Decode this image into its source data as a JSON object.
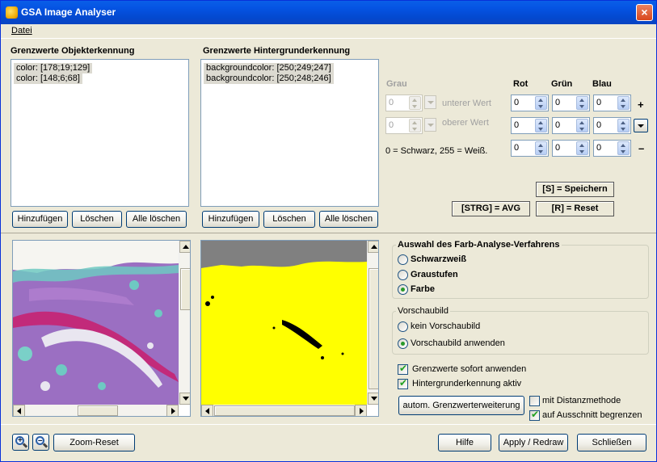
{
  "window": {
    "title": "GSA Image Analyser",
    "close": "×"
  },
  "menu": {
    "file": "Datei"
  },
  "object_thresholds": {
    "title": "Grenzwerte Objekterkennung",
    "items": [
      "color:  [178;19;129]",
      "color:  [148;6;68]"
    ],
    "buttons": {
      "add": "Hinzufügen",
      "delete": "Löschen",
      "delete_all": "Alle löschen"
    }
  },
  "background_thresholds": {
    "title": "Grenzwerte Hintergrunderkennung",
    "items": [
      "backgroundcolor:  [250;249;247]",
      "backgroundcolor:  [250;248;246]"
    ],
    "buttons": {
      "add": "Hinzufügen",
      "delete": "Löschen",
      "delete_all": "Alle löschen"
    }
  },
  "color_values": {
    "headers": {
      "gray": "Grau",
      "red": "Rot",
      "green": "Grün",
      "blue": "Blau"
    },
    "lower_label": "unterer Wert",
    "upper_label": "oberer Wert",
    "scale_note": "0 = Schwarz, 255 = Weiß.",
    "gray_lower": "0",
    "gray_upper": "0",
    "rows": [
      {
        "r": "0",
        "g": "0",
        "b": "0",
        "sign": "+"
      },
      {
        "r": "0",
        "g": "0",
        "b": "0",
        "sign": ""
      },
      {
        "r": "0",
        "g": "0",
        "b": "0",
        "sign": "–"
      }
    ]
  },
  "shortcuts": {
    "save": "[S] = Speichern",
    "avg": "[STRG] = AVG",
    "reset": "[R] = Reset"
  },
  "analysis_method": {
    "title": "Auswahl des Farb-Analyse-Verfahrens",
    "options": [
      "Schwarzweiß",
      "Graustufen",
      "Farbe"
    ],
    "selected": "Farbe"
  },
  "preview": {
    "title": "Vorschaubild",
    "options": [
      "kein Vorschaubild",
      "Vorschaubild anwenden"
    ],
    "selected": "Vorschaubild anwenden"
  },
  "options": {
    "apply_immediately": "Grenzwerte sofort anwenden",
    "background_active": "Hintergrunderkennung aktiv",
    "auto_extend": "autom. Grenzwerterweiterung",
    "distance_method": "mit Distanzmethode",
    "limit_to_section": "auf Ausschnitt begrenzen"
  },
  "bottom": {
    "zoom_reset": "Zoom-Reset",
    "help": "Hilfe",
    "apply": "Apply / Redraw",
    "close": "Schließen"
  }
}
